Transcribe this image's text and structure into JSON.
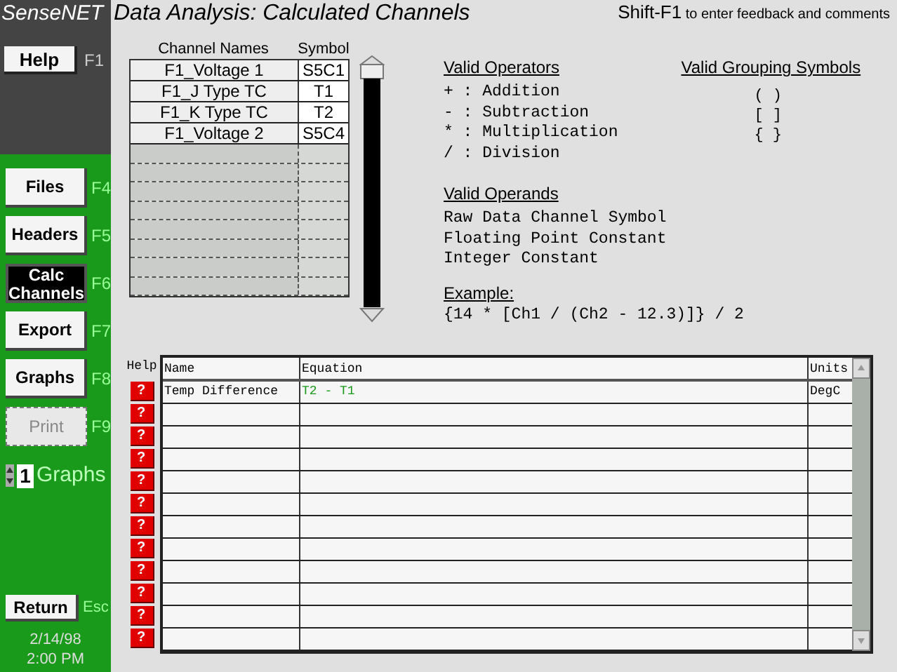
{
  "app_title": "SenseNET",
  "page_title": "Data Analysis: Calculated Channels",
  "feedback_hint": {
    "key": "Shift-F1",
    "text": "to enter feedback and comments"
  },
  "sidebar": {
    "help": {
      "label": "Help",
      "key": "F1"
    },
    "items": [
      {
        "label": "Files",
        "key": "F4",
        "selected": false,
        "disabled": false
      },
      {
        "label": "Headers",
        "key": "F5",
        "selected": false,
        "disabled": false
      },
      {
        "label": "Calc Channels",
        "key": "F6",
        "selected": true,
        "disabled": false
      },
      {
        "label": "Export",
        "key": "F7",
        "selected": false,
        "disabled": false
      },
      {
        "label": "Graphs",
        "key": "F8",
        "selected": false,
        "disabled": false
      },
      {
        "label": "Print",
        "key": "F9",
        "selected": false,
        "disabled": true
      }
    ],
    "graphs_count": {
      "value": "1",
      "label": "Graphs"
    },
    "return": {
      "label": "Return",
      "key": "Esc"
    },
    "date": "2/14/98",
    "time": "2:00 PM"
  },
  "channels": {
    "columns": [
      "Channel Names",
      "Symbol"
    ],
    "rows": [
      {
        "name": "F1_Voltage 1",
        "symbol": "S5C1"
      },
      {
        "name": "F1_J Type TC",
        "symbol": "T1"
      },
      {
        "name": "F1_K Type TC",
        "symbol": "T2"
      },
      {
        "name": "F1_Voltage 2",
        "symbol": "S5C4"
      }
    ]
  },
  "operators": {
    "title": "Valid Operators",
    "items": [
      "+ : Addition",
      "- : Subtraction",
      "* : Multiplication",
      "/ : Division"
    ]
  },
  "grouping": {
    "title": "Valid Grouping Symbols",
    "items": [
      "( )",
      "[ ]",
      "{ }"
    ]
  },
  "operands": {
    "title": "Valid Operands",
    "items": [
      "Raw Data Channel Symbol",
      "Floating Point Constant",
      "Integer Constant"
    ]
  },
  "example": {
    "title": "Example:",
    "text": "{14 * [Ch1 / (Ch2 - 12.3)]} / 2"
  },
  "equations": {
    "columns": [
      "Help",
      "Name",
      "Equation",
      "Units"
    ],
    "rows": [
      {
        "help": "?",
        "name": "Temp Difference",
        "equation": "T2 - T1",
        "units": "DegC"
      },
      {
        "help": "?"
      },
      {
        "help": "?"
      },
      {
        "help": "?"
      },
      {
        "help": "?"
      },
      {
        "help": "?"
      },
      {
        "help": "?"
      },
      {
        "help": "?"
      },
      {
        "help": "?"
      },
      {
        "help": "?"
      },
      {
        "help": "?"
      },
      {
        "help": "?"
      }
    ]
  }
}
